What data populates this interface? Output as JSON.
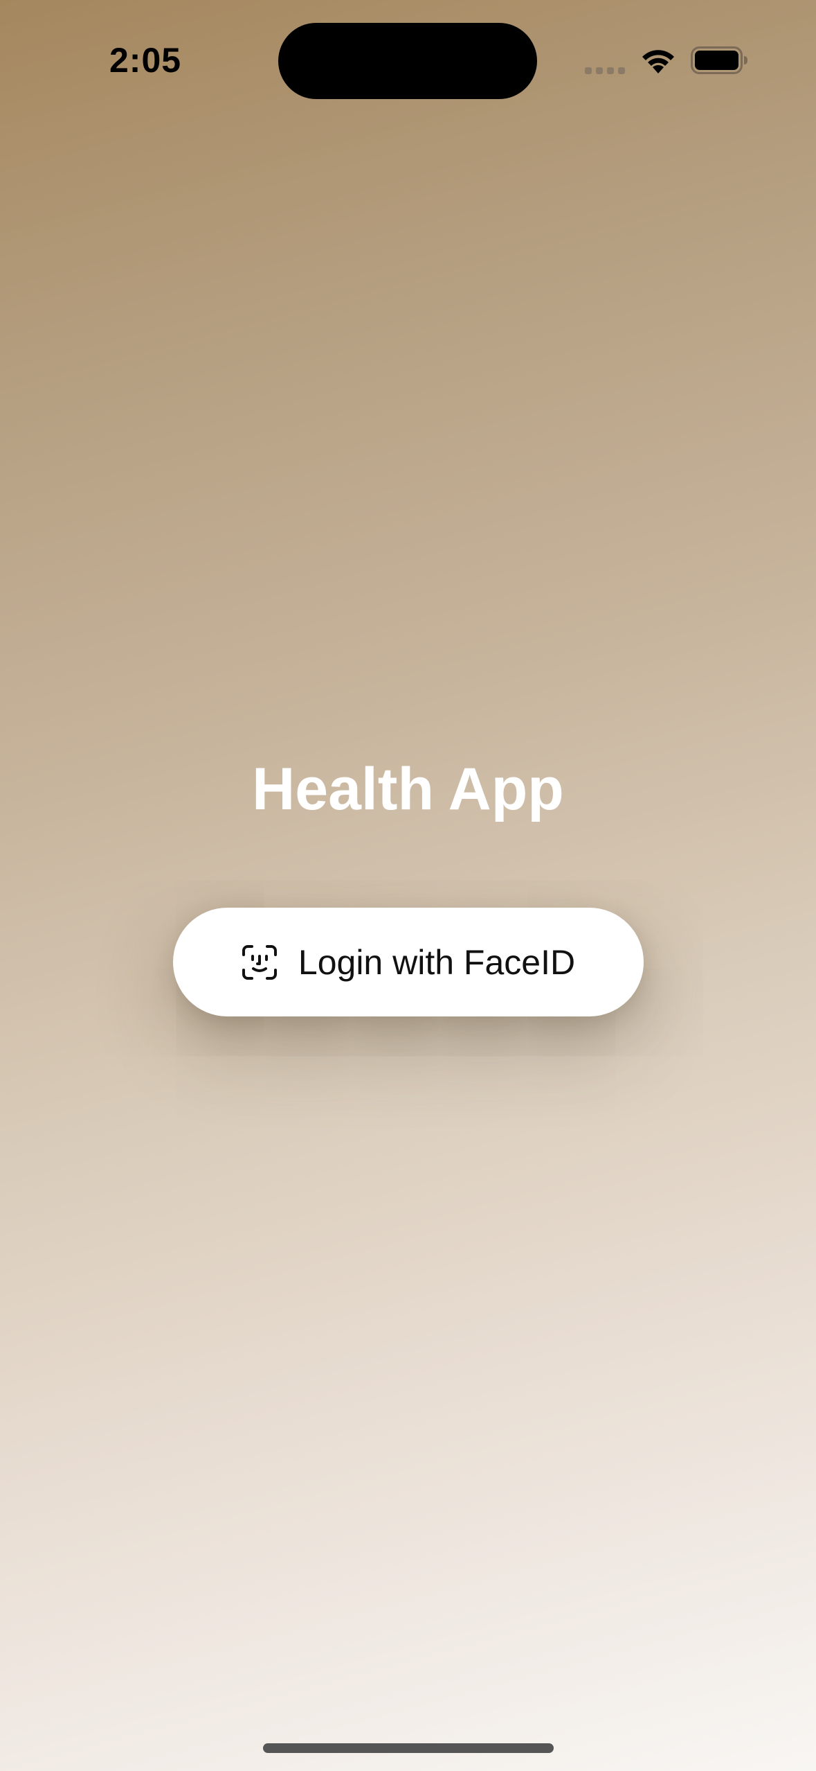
{
  "status_bar": {
    "time": "2:05",
    "icons": [
      "cellular-signal-icon",
      "wifi-icon",
      "battery-icon"
    ]
  },
  "main": {
    "title": "Health App",
    "login_button": {
      "label": "Login with FaceID",
      "icon": "faceid-icon"
    }
  },
  "colors": {
    "gradient_top": "#a5875e",
    "gradient_bottom": "#f8f6f3",
    "title_text": "#ffffff",
    "button_background": "#ffffff"
  }
}
